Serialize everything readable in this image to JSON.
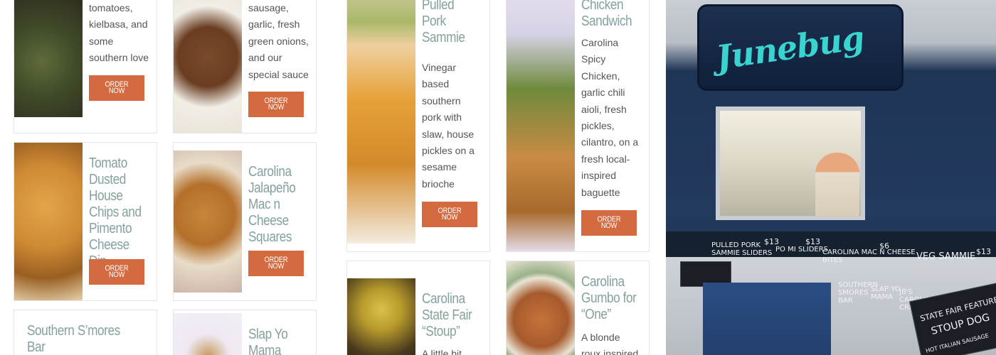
{
  "menu": {
    "order_label": "ORDER\nNOW",
    "items": [
      {
        "id": "tomatoes",
        "desc": "tomatoes,\nkielbasa, and\nsome\nsouthern love"
      },
      {
        "id": "sausage",
        "desc": "sausage,\ngarlic, fresh\ngreen onions,\nand our\nspecial sauce"
      },
      {
        "id": "chips",
        "title": "Tomato\nDusted\nHouse\nChips and\nPimento\nCheese Dip"
      },
      {
        "id": "mac",
        "title": "Carolina\nJalapeño\nMac n\nCheese\nSquares"
      },
      {
        "id": "smores",
        "title": "Southern S’mores\nBar"
      },
      {
        "id": "slapyo",
        "title": "Slap Yo\nMama"
      },
      {
        "id": "pork",
        "title": "Carolina\nPulled\nPork\nSammie",
        "desc": "Vinegar\nbased\nsouthern\npork with\nslaw, house\npickles on a\nsesame\nbrioche"
      },
      {
        "id": "chicken",
        "title": "Chicken\nSandwich",
        "desc": "Carolina\nSpicy\nChicken,\ngarlic chili\naioli, fresh\npickles,\ncilantro, on a\nfresh local-\ninspired\nbaguette"
      },
      {
        "id": "stoup",
        "title": "Carolina\nState Fair\n“Stoup”",
        "desc": "A little bit"
      },
      {
        "id": "gumbo",
        "title": "Carolina\nGumbo for\n“One”",
        "desc": "A blonde\nroux inspired"
      }
    ]
  },
  "truck": {
    "logo": "Junebug",
    "board": {
      "pulled_pork": "PULLED PORK\nSAMMIE SLIDERS",
      "po_mi": "PO MI SLIDERS",
      "mac": "CAROLINA MAC N CHEESE\nBITES",
      "veg": "VEG SAMMIE",
      "price_13a": "$13",
      "price_13b": "$13",
      "price_6": "$6",
      "price_13c": "$13",
      "smores": "SOUTHERN\nSMORES\nBAR",
      "slap": "SLAP YO\nMAMA",
      "jbs": "JB'S\nCAROLINA\nCRISPY",
      "feature": "STATE FAIR FEATURE",
      "stoup": "STOUP DOG",
      "feature_sub": "HOT ITALIAN SAUSAGE"
    }
  }
}
